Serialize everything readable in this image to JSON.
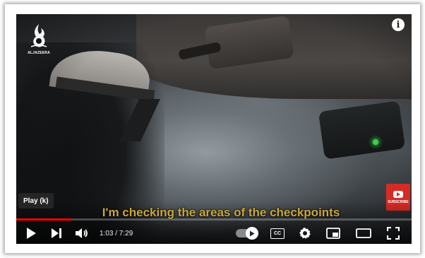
{
  "channel": {
    "logo_icon": "al-jazeera-logo-icon",
    "logo_text": "ALJAZEERA"
  },
  "overlay": {
    "info_label": "i",
    "tooltip": "Play (k)",
    "subscribe_label": "SUBSCRIBE",
    "subtitle": "I'm checking the areas of the checkpoints"
  },
  "playback": {
    "current_time": "1:03",
    "duration": "7:29",
    "time_display": "1:03 / 7:29",
    "progress_fraction": 0.14
  },
  "controls": {
    "cc_label": "CC",
    "icons": [
      "play-icon",
      "next-icon",
      "volume-icon",
      "autoplay-toggle",
      "subtitles-icon",
      "settings-icon",
      "miniplayer-icon",
      "theater-mode-icon",
      "fullscreen-icon"
    ]
  },
  "colors": {
    "progress": "#ff0000",
    "subtitle": "#c9a83a",
    "subscribe": "#d62b25"
  }
}
